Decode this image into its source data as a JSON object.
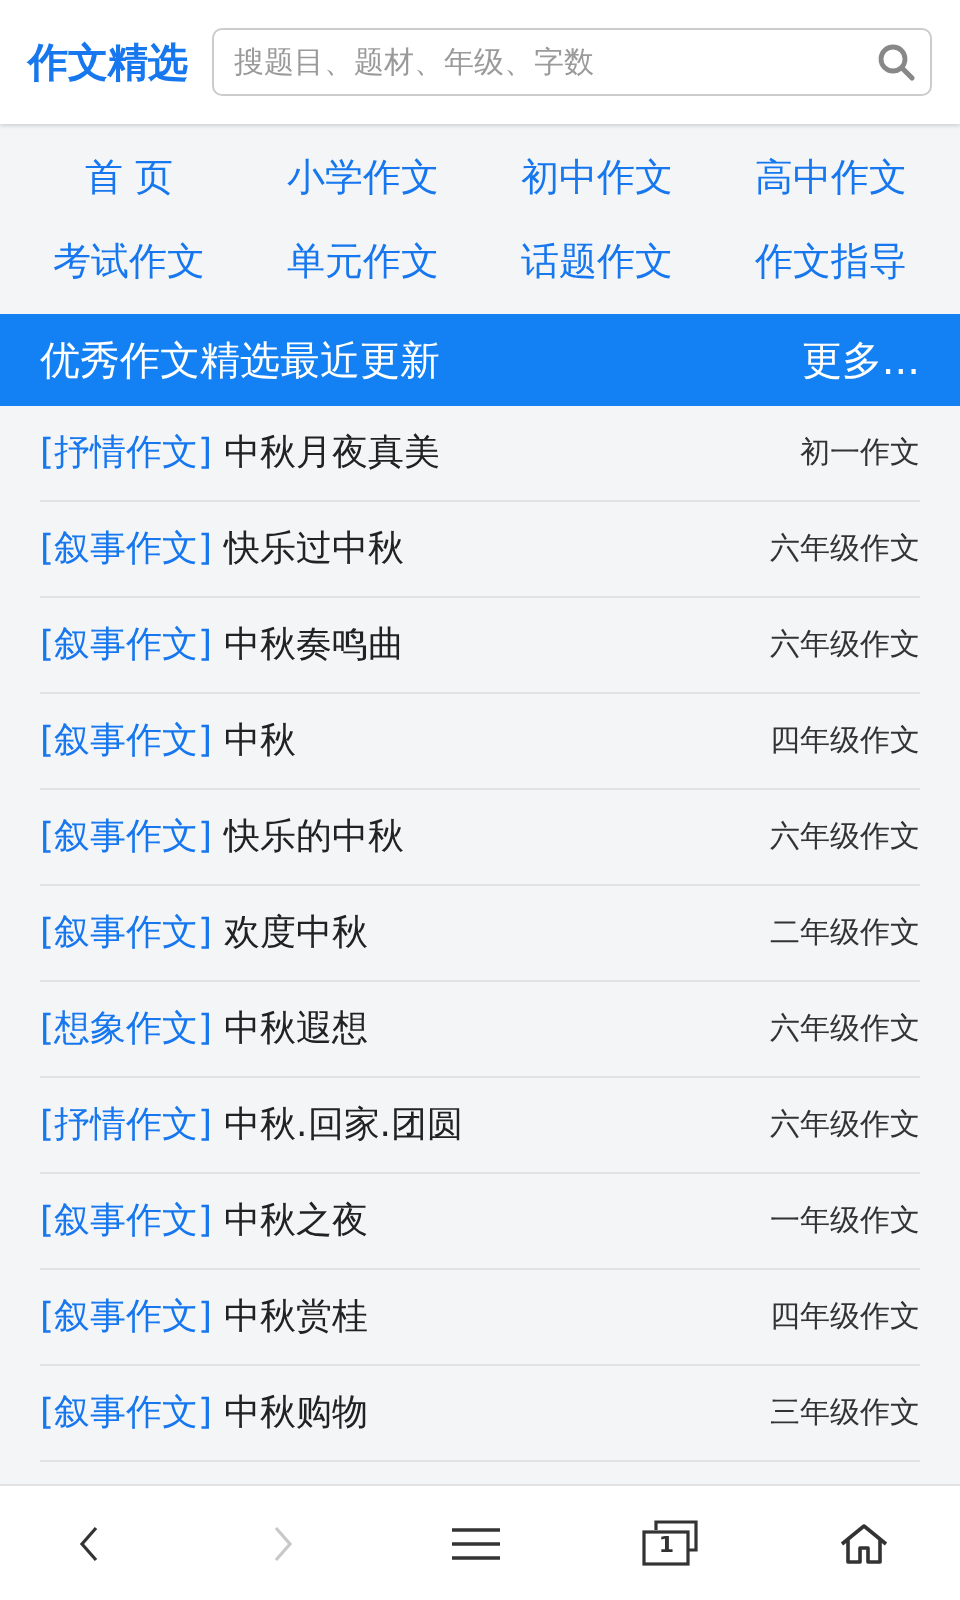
{
  "header": {
    "logo": "作文精选",
    "search": {
      "placeholder": "搜题目、题材、年级、字数"
    }
  },
  "nav": [
    "首 页",
    "小学作文",
    "初中作文",
    "高中作文",
    "考试作文",
    "单元作文",
    "话题作文",
    "作文指导"
  ],
  "section": {
    "title": "优秀作文精选最近更新",
    "more": "更多..."
  },
  "articles": [
    {
      "tag": "[抒情作文]",
      "title": "中秋月夜真美",
      "grade": "初一作文"
    },
    {
      "tag": "[叙事作文]",
      "title": "快乐过中秋",
      "grade": "六年级作文"
    },
    {
      "tag": "[叙事作文]",
      "title": "中秋奏鸣曲",
      "grade": "六年级作文"
    },
    {
      "tag": "[叙事作文]",
      "title": "中秋",
      "grade": "四年级作文"
    },
    {
      "tag": "[叙事作文]",
      "title": "快乐的中秋",
      "grade": "六年级作文"
    },
    {
      "tag": "[叙事作文]",
      "title": "欢度中秋",
      "grade": "二年级作文"
    },
    {
      "tag": "[想象作文]",
      "title": "中秋遐想",
      "grade": "六年级作文"
    },
    {
      "tag": "[抒情作文]",
      "title": "中秋.回家.团圆",
      "grade": "六年级作文"
    },
    {
      "tag": "[叙事作文]",
      "title": "中秋之夜",
      "grade": "一年级作文"
    },
    {
      "tag": "[叙事作文]",
      "title": "中秋赏桂",
      "grade": "四年级作文"
    },
    {
      "tag": "[叙事作文]",
      "title": "中秋购物",
      "grade": "三年级作文"
    }
  ],
  "toolbar": [
    {
      "kind": "back",
      "disabled": false
    },
    {
      "kind": "forward",
      "disabled": true
    },
    {
      "kind": "menu",
      "disabled": false
    },
    {
      "kind": "tabs",
      "count": "1",
      "disabled": false
    },
    {
      "kind": "home",
      "disabled": false
    }
  ]
}
